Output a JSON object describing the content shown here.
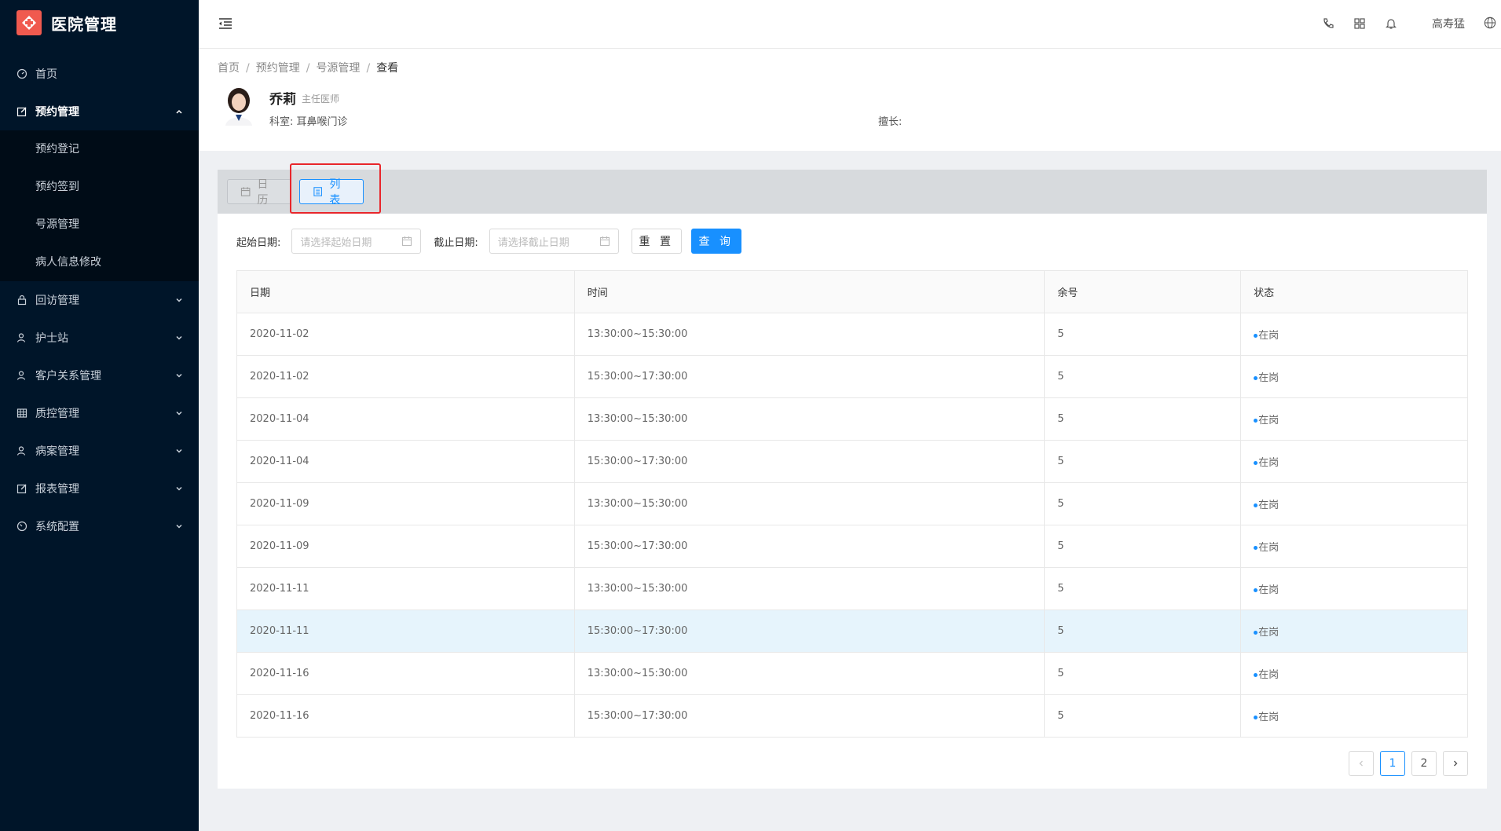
{
  "app": {
    "title": "医院管理"
  },
  "sidebar": {
    "items": [
      {
        "label": "首页",
        "icon": "dashboard-icon"
      },
      {
        "label": "预约管理",
        "icon": "edit-icon",
        "open": true,
        "children": [
          "预约登记",
          "预约签到",
          "号源管理",
          "病人信息修改"
        ]
      },
      {
        "label": "回访管理",
        "icon": "lock-icon"
      },
      {
        "label": "护士站",
        "icon": "user-icon"
      },
      {
        "label": "客户关系管理",
        "icon": "user-icon"
      },
      {
        "label": "质控管理",
        "icon": "table-icon"
      },
      {
        "label": "病案管理",
        "icon": "user-icon"
      },
      {
        "label": "报表管理",
        "icon": "edit-icon"
      },
      {
        "label": "系统配置",
        "icon": "gauge-icon"
      }
    ]
  },
  "header": {
    "username": "高寿猛"
  },
  "breadcrumb": [
    "首页",
    "预约管理",
    "号源管理",
    "查看"
  ],
  "doctor": {
    "name": "乔莉",
    "title": "主任医师",
    "department": "科室: 耳鼻喉门诊",
    "specialty": "擅长:"
  },
  "view_toggle": {
    "calendar": "日历",
    "list": "列表"
  },
  "filters": {
    "start_label": "起始日期:",
    "start_placeholder": "请选择起始日期",
    "end_label": "截止日期:",
    "end_placeholder": "请选择截止日期",
    "reset": "重 置",
    "query": "查 询"
  },
  "table": {
    "headers": [
      "日期",
      "时间",
      "余号",
      "状态"
    ],
    "rows": [
      [
        "2020-11-02",
        "13:30:00~15:30:00",
        "5",
        "在岗"
      ],
      [
        "2020-11-02",
        "15:30:00~17:30:00",
        "5",
        "在岗"
      ],
      [
        "2020-11-04",
        "13:30:00~15:30:00",
        "5",
        "在岗"
      ],
      [
        "2020-11-04",
        "15:30:00~17:30:00",
        "5",
        "在岗"
      ],
      [
        "2020-11-09",
        "13:30:00~15:30:00",
        "5",
        "在岗"
      ],
      [
        "2020-11-09",
        "15:30:00~17:30:00",
        "5",
        "在岗"
      ],
      [
        "2020-11-11",
        "13:30:00~15:30:00",
        "5",
        "在岗"
      ],
      [
        "2020-11-11",
        "15:30:00~17:30:00",
        "5",
        "在岗"
      ],
      [
        "2020-11-16",
        "13:30:00~15:30:00",
        "5",
        "在岗"
      ],
      [
        "2020-11-16",
        "15:30:00~17:30:00",
        "5",
        "在岗"
      ]
    ]
  },
  "pagination": {
    "pages": [
      "1",
      "2"
    ],
    "current": "1"
  },
  "colors": {
    "primary": "#1890ff",
    "sidebar": "#001529",
    "highlight": "#e8262b"
  }
}
